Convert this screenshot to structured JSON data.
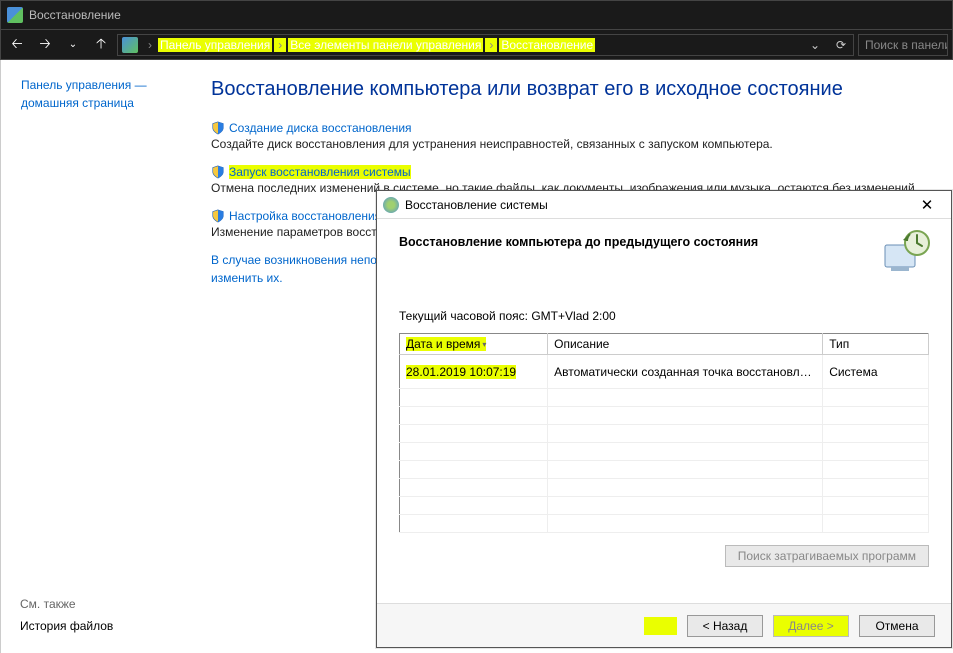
{
  "window": {
    "title": "Восстановление"
  },
  "breadcrumb": {
    "items": [
      "Панель управления",
      "Все элементы панели управления",
      "Восстановление"
    ]
  },
  "search": {
    "placeholder": "Поиск в панели"
  },
  "sidebar": {
    "home": "Панель управления — домашняя страница",
    "see_also_label": "См. также",
    "see_also_link": "История файлов"
  },
  "page": {
    "title": "Восстановление компьютера или возврат его в исходное состояние",
    "tasks": [
      {
        "link": "Создание диска восстановления",
        "desc": "Создайте диск восстановления для устранения неисправностей, связанных с запуском компьютера."
      },
      {
        "link": "Запуск восстановления системы",
        "desc": "Отмена последних изменений в системе, но такие файлы, как документы, изображения или музыка, остаются без изменений."
      },
      {
        "link": "Настройка восстановления системы",
        "desc": "Изменение параметров восстановления, управление дисковым пространством и удаление точек восстановления."
      }
    ],
    "help": {
      "line1": "В случае возникновения неполадок с компьютером перейдите на страницу «Параметры» и попробуйте",
      "line2": "изменить их."
    }
  },
  "dialog": {
    "title": "Восстановление системы",
    "heading": "Восстановление компьютера до предыдущего состояния",
    "tz_label": "Текущий часовой пояс: GMT+Vlad 2:00",
    "columns": {
      "date": "Дата и время",
      "desc": "Описание",
      "type": "Тип"
    },
    "rows": [
      {
        "date": "28.01.2019 10:07:19",
        "desc": "Автоматически созданная точка восстановле...",
        "type": "Система"
      }
    ],
    "affected_btn": "Поиск затрагиваемых программ",
    "buttons": {
      "back": "< Назад",
      "next": "Далее >",
      "cancel": "Отмена"
    }
  }
}
